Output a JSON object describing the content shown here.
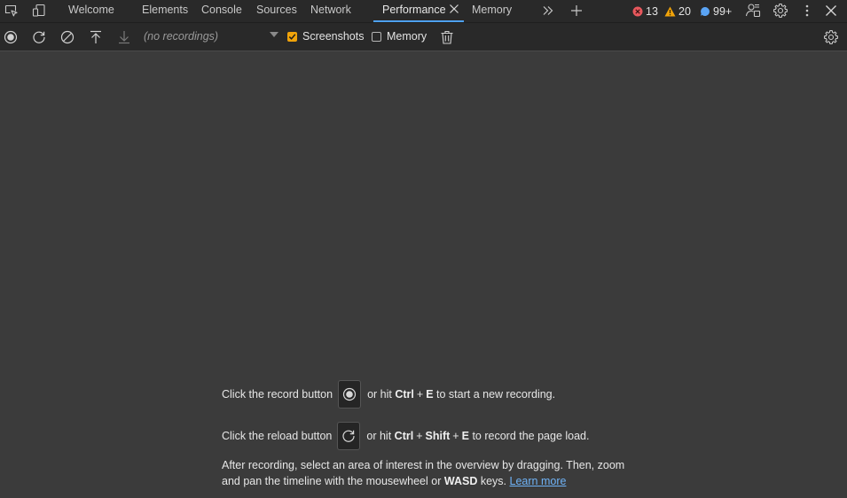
{
  "tabbar": {
    "tabs": [
      {
        "label": "Welcome"
      },
      {
        "label": "Elements"
      },
      {
        "label": "Console"
      },
      {
        "label": "Sources"
      },
      {
        "label": "Network"
      },
      {
        "label": "Performance"
      },
      {
        "label": "Memory"
      }
    ],
    "active_tab": "Performance",
    "errors_count": "13",
    "warnings_count": "20",
    "issues_count": "99+",
    "icons": [
      "inspect-element-icon",
      "device-toolbar-icon",
      "close-tab-icon",
      "more-tabs-icon",
      "add-tab-icon",
      "error-icon",
      "warning-icon",
      "issues-icon",
      "customize-icon",
      "settings-icon",
      "more-options-icon",
      "close-devtools-icon"
    ]
  },
  "toolbar": {
    "recordings_placeholder": "(no recordings)",
    "screenshots_label": "Screenshots",
    "screenshots_checked": true,
    "memory_label": "Memory",
    "memory_checked": false,
    "icons": [
      "record-icon",
      "reload-record-icon",
      "clear-icon",
      "load-profile-icon",
      "save-profile-icon",
      "dropdown-icon",
      "trash-icon",
      "capture-settings-icon"
    ]
  },
  "landing": {
    "line1_prefix": "Click the record button",
    "line1_middle": "or hit",
    "line1_key1": "Ctrl",
    "line1_key2": "E",
    "line1_suffix": "to start a new recording.",
    "line2_prefix": "Click the reload button",
    "line2_middle": "or hit",
    "line2_key1": "Ctrl",
    "line2_key2": "Shift",
    "line2_key3": "E",
    "line2_suffix": "to record the page load.",
    "para_part1": "After recording, select an area of interest in the overview by dragging. Then, zoom and pan the timeline with the mousewheel or",
    "para_key": "WASD",
    "para_part2": "keys.",
    "learn_more": "Learn more",
    "plus_sign": "+"
  },
  "colors": {
    "accent": "#4ea1f3",
    "checkbox_checked": "#f0a30a",
    "error": "#e8585d",
    "warning": "#f0a30a",
    "issue": "#5aa4f5",
    "link": "#6fb3f7"
  }
}
